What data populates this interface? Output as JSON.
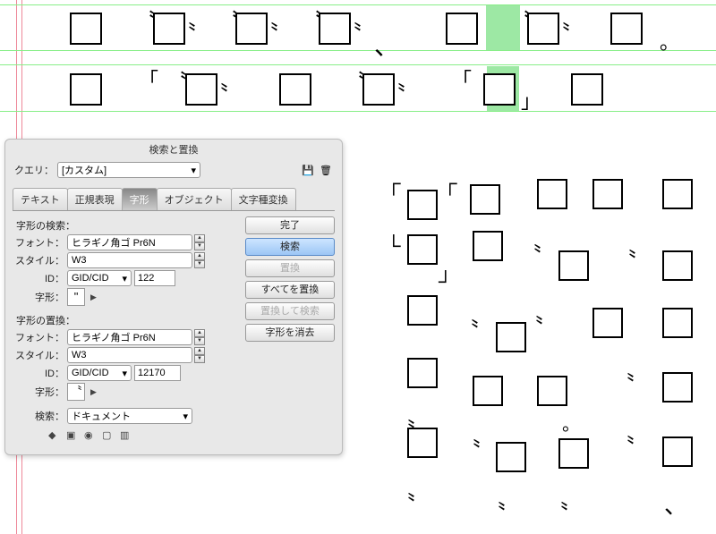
{
  "panel": {
    "title": "検索と置換",
    "query_label": "クエリ：",
    "query_value": "[カスタム]",
    "tabs": [
      "テキスト",
      "正規表現",
      "字形",
      "オブジェクト",
      "文字種変換"
    ],
    "active_tab": 2,
    "search_section": "字形の検索：",
    "replace_section": "字形の置換：",
    "font_label": "フォント：",
    "style_label": "スタイル：",
    "id_label": "ID：",
    "glyph_label": "字形：",
    "scope_label": "検索：",
    "search": {
      "font": "ヒラギノ角ゴ Pr6N",
      "style": "W3",
      "id_type": "GID/CID",
      "id_value": "122",
      "glyph": "\""
    },
    "replace": {
      "font": "ヒラギノ角ゴ Pr6N",
      "style": "W3",
      "id_type": "GID/CID",
      "id_value": "12170",
      "glyph": "〝"
    },
    "scope": "ドキュメント",
    "buttons": {
      "done": "完了",
      "find": "検索",
      "change": "置換",
      "change_all": "すべてを置換",
      "change_find": "置換して検索",
      "clear": "字形を消去"
    }
  },
  "icons": {
    "save": "save-icon",
    "trash": "trash-icon"
  }
}
